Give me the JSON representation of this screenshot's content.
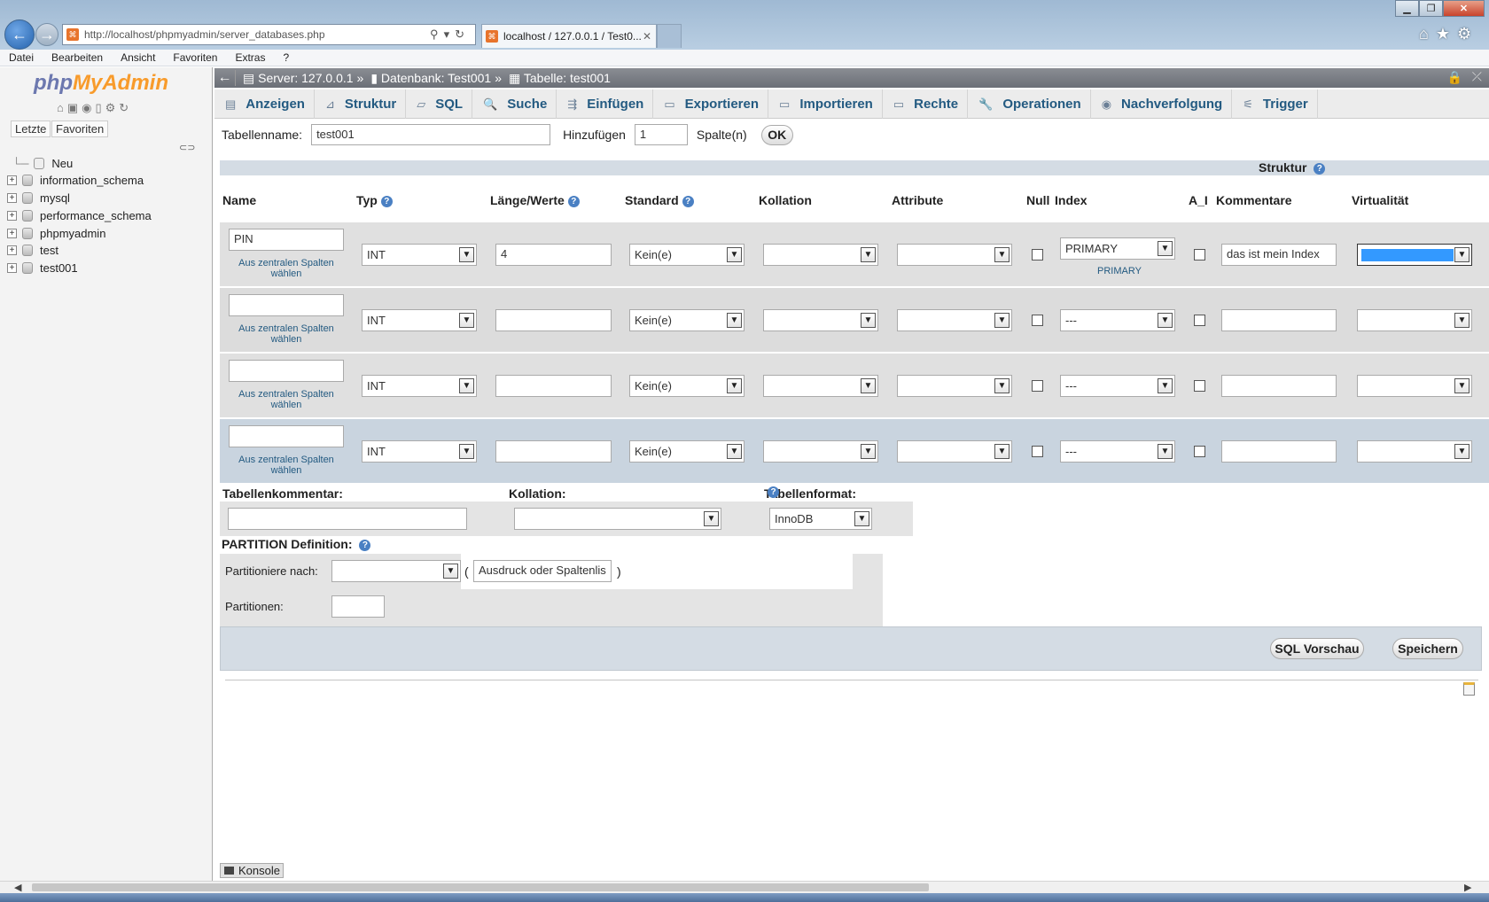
{
  "browser": {
    "url": "http://localhost/phpmyadmin/server_databases.php",
    "url_host": "localhost",
    "tab_title": "localhost / 127.0.0.1 / Test0...",
    "menu": [
      "Datei",
      "Bearbeiten",
      "Ansicht",
      "Favoriten",
      "Extras",
      "?"
    ]
  },
  "sidebar": {
    "logo_php": "php",
    "logo_my": "MyAdmin",
    "tabs": [
      "Letzte",
      "Favoriten"
    ],
    "tree": [
      "Neu",
      "information_schema",
      "mysql",
      "performance_schema",
      "phpmyadmin",
      "test",
      "test001"
    ]
  },
  "breadcrumb": {
    "server": "Server: 127.0.0.1",
    "database": "Datenbank: Test001",
    "table": "Tabelle: test001",
    "separator": "»"
  },
  "tabs": [
    "Anzeigen",
    "Struktur",
    "SQL",
    "Suche",
    "Einfügen",
    "Exportieren",
    "Importieren",
    "Rechte",
    "Operationen",
    "Nachverfolgung",
    "Trigger"
  ],
  "form": {
    "table_name_label": "Tabellenname:",
    "table_name": "test001",
    "add_label": "Hinzufügen",
    "add_count": "1",
    "columns_label": "Spalte(n)",
    "ok_label": "OK",
    "structure_label": "Struktur"
  },
  "headers": {
    "name": "Name",
    "type": "Typ",
    "length": "Länge/Werte",
    "default": "Standard",
    "collation": "Kollation",
    "attributes": "Attribute",
    "null": "Null",
    "index": "Index",
    "ai": "A_I",
    "comments": "Kommentare",
    "virtuality": "Virtualität"
  },
  "central_columns_link": "Aus zentralen Spalten wählen",
  "rows": [
    {
      "name": "PIN",
      "type": "INT",
      "length": "4",
      "default": "Kein(e)",
      "index": "PRIMARY",
      "index_note": "PRIMARY",
      "comment": "das ist mein Index"
    },
    {
      "name": "",
      "type": "INT",
      "length": "",
      "default": "Kein(e)",
      "index": "---",
      "index_note": "",
      "comment": ""
    },
    {
      "name": "",
      "type": "INT",
      "length": "",
      "default": "Kein(e)",
      "index": "---",
      "index_note": "",
      "comment": ""
    },
    {
      "name": "",
      "type": "INT",
      "length": "",
      "default": "Kein(e)",
      "index": "---",
      "index_note": "",
      "comment": ""
    }
  ],
  "table_options": {
    "comment_label": "Tabellenkommentar:",
    "collation_label": "Kollation:",
    "format_label": "Tabellenformat:",
    "format_value": "InnoDB"
  },
  "partition": {
    "title": "PARTITION Definition:",
    "by_label": "Partitioniere nach:",
    "expr_placeholder": "Ausdruck oder Spaltenlis",
    "count_label": "Partitionen:"
  },
  "buttons": {
    "preview": "SQL Vorschau",
    "save": "Speichern"
  },
  "console_label": "Konsole",
  "colors": {
    "link": "#235a81",
    "header_bar": "#6b6f77",
    "struktur_bar": "#d4dce4"
  }
}
